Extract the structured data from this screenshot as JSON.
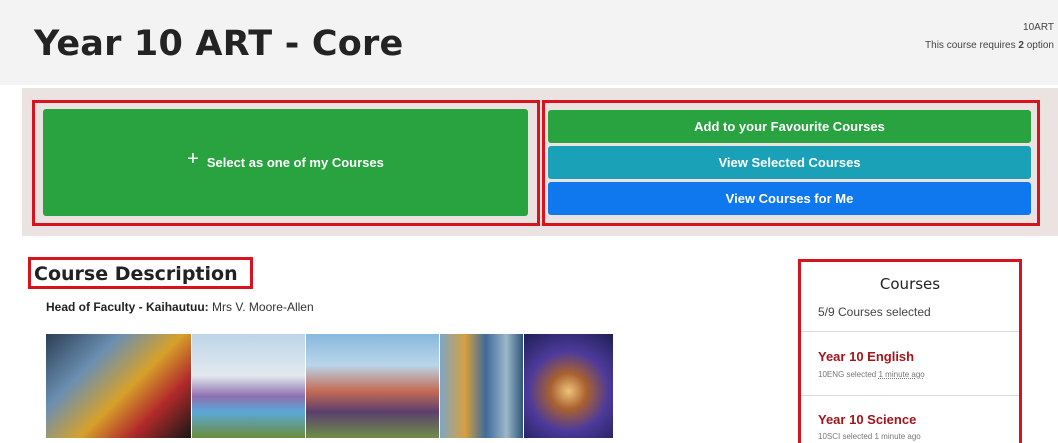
{
  "header": {
    "title": "Year 10 ART - Core",
    "course_code": "10ART",
    "requirement_prefix": "This course requires",
    "requirement_count": "2",
    "requirement_suffix": "option"
  },
  "actions": {
    "select_icon": "+",
    "select_label": "Select as one of my Courses",
    "favourite_label": "Add to your Favourite Courses",
    "view_selected_label": "View Selected Courses",
    "view_for_me_label": "View Courses for Me",
    "colors": {
      "green": "#28a33f",
      "teal": "#1aa1b8",
      "blue": "#1078ef",
      "highlight": "#d7141d"
    }
  },
  "description": {
    "heading": "Course Description",
    "faculty_label": "Head of Faculty - Kaihautuu:",
    "faculty_name": "Mrs V. Moore-Allen"
  },
  "courses_panel": {
    "title": "Courses",
    "count_text": "5/9 Courses selected",
    "items": [
      {
        "name": "Year 10 English",
        "meta": "10ENG selected",
        "time": "1 minute ago"
      },
      {
        "name": "Year 10 Science",
        "meta": "10SCI selected",
        "time": "1 minute ago"
      }
    ]
  }
}
